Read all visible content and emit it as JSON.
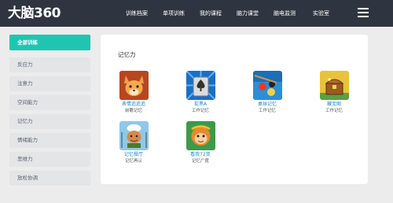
{
  "header": {
    "logo": "大脑360",
    "nav": [
      "训练档案",
      "单项训练",
      "我的课程",
      "脑力课堂",
      "脑电监测",
      "实验室"
    ]
  },
  "sidebar": {
    "items": [
      {
        "label": "全部训练",
        "active": true
      },
      {
        "label": "反应力",
        "active": false
      },
      {
        "label": "注意力",
        "active": false
      },
      {
        "label": "空间能力",
        "active": false
      },
      {
        "label": "记忆力",
        "active": false
      },
      {
        "label": "情绪能力",
        "active": false
      },
      {
        "label": "思维力",
        "active": false
      },
      {
        "label": "放松协调",
        "active": false
      }
    ]
  },
  "main": {
    "section_title": "记忆力",
    "games": [
      {
        "name": "表情追追追",
        "category": "前瞻记忆",
        "icon": "fox-icon"
      },
      {
        "name": "捉黑A",
        "category": "工作记忆",
        "icon": "spade-card-icon"
      },
      {
        "name": "桌球记忆",
        "category": "工作记忆",
        "icon": "billiards-icon"
      },
      {
        "name": "藏宝图",
        "category": "工作记忆",
        "icon": "treasure-chest-icon"
      },
      {
        "name": "记忆餐厅",
        "category": "记忆再认",
        "icon": "chef-icon"
      },
      {
        "name": "看我72变",
        "category": "记忆广度",
        "icon": "monkey-king-icon"
      }
    ]
  },
  "colors": {
    "topbar": "#2f3540",
    "accent": "#1ec6b2",
    "link": "#1e88c9"
  }
}
